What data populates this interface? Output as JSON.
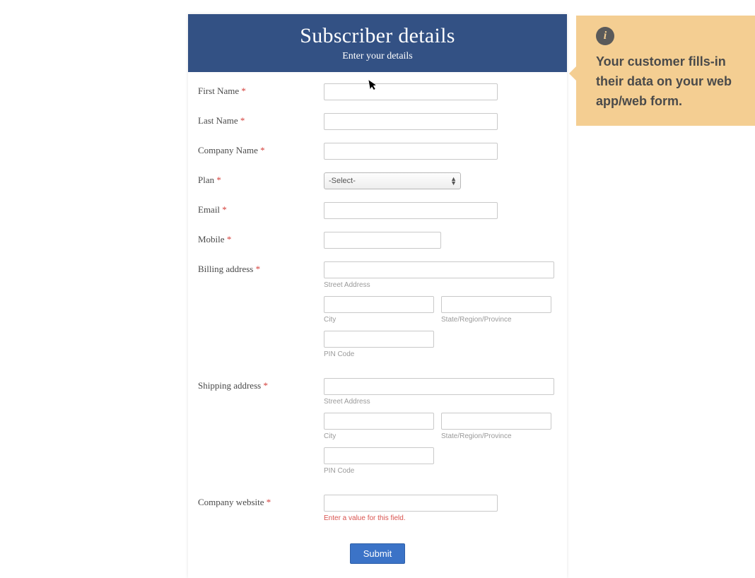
{
  "header": {
    "title": "Subscriber details",
    "subtitle": "Enter your details"
  },
  "labels": {
    "firstName": "First Name",
    "lastName": "Last Name",
    "companyName": "Company Name",
    "plan": "Plan",
    "email": "Email",
    "mobile": "Mobile",
    "billingAddress": "Billing address",
    "shippingAddress": "Shipping address",
    "companyWebsite": "Company website"
  },
  "required": "*",
  "planSelect": {
    "selected": "-Select-"
  },
  "subLabels": {
    "street": "Street Address",
    "city": "City",
    "state": "State/Region/Province",
    "pin": "PIN Code"
  },
  "errors": {
    "companyWebsite": "Enter a value for this field."
  },
  "submitLabel": "Submit",
  "tooltip": {
    "iconGlyph": "i",
    "text": "Your customer fills-in their data on your web app/web form."
  },
  "cursorGlyph": "➤"
}
